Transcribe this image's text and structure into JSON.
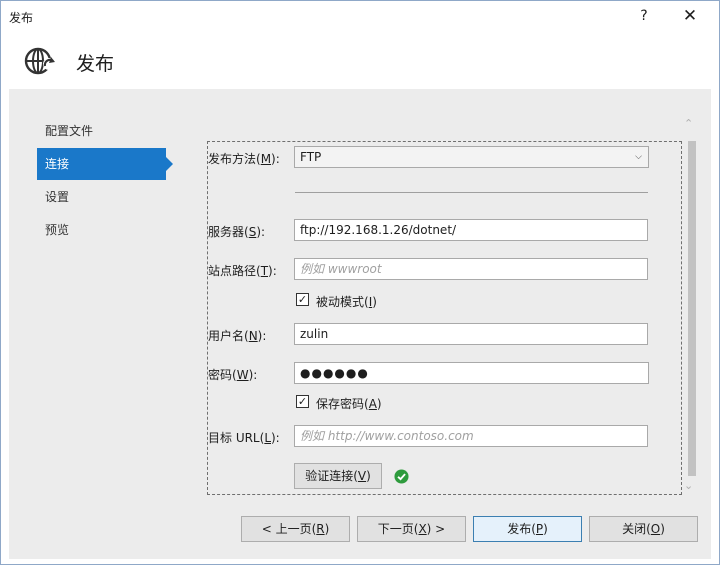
{
  "window": {
    "title": "发布",
    "help_label": "?",
    "close_label": "✕"
  },
  "header": {
    "title": "发布",
    "icon": "globe-publish-icon"
  },
  "nav": {
    "items": [
      {
        "label": "配置文件",
        "active": false
      },
      {
        "label": "连接",
        "active": true
      },
      {
        "label": "设置",
        "active": false
      },
      {
        "label": "预览",
        "active": false
      }
    ]
  },
  "form": {
    "method_label": "发布方法(",
    "method_key": "M",
    "method_value": "FTP",
    "server_label": "服务器(",
    "server_key": "S",
    "server_value": "ftp://192.168.1.26/dotnet/",
    "sitepath_label": "站点路径(",
    "sitepath_key": "T",
    "sitepath_placeholder": "例如 wwwroot",
    "passive_label": "被动模式(",
    "passive_key": "I",
    "passive_checked": true,
    "username_label": "用户名(",
    "username_key": "N",
    "username_value": "zulin",
    "password_label": "密码(",
    "password_key": "W",
    "password_value": "●●●●●●",
    "savepwd_label": "保存密码(",
    "savepwd_key": "A",
    "savepwd_checked": true,
    "url_label": "目标 URL(",
    "url_key": "L",
    "url_placeholder": "例如 http://www.contoso.com",
    "validate_label": "验证连接(",
    "validate_key": "V",
    "validate_status_icon": "success-check-icon",
    "close_paren": "):",
    "close_paren_plain": ")"
  },
  "footer": {
    "prev_label": "< 上一页(",
    "prev_key": "R",
    "prev_tail": ")",
    "next_label": "下一页(",
    "next_key": "X",
    "next_tail": ") >",
    "publish_label": "发布(",
    "publish_key": "P",
    "publish_tail": ")",
    "close_label": "关闭(",
    "close_key": "O",
    "close_tail": ")"
  },
  "colors": {
    "accent": "#1a78c9",
    "success": "#2e9b3d"
  }
}
